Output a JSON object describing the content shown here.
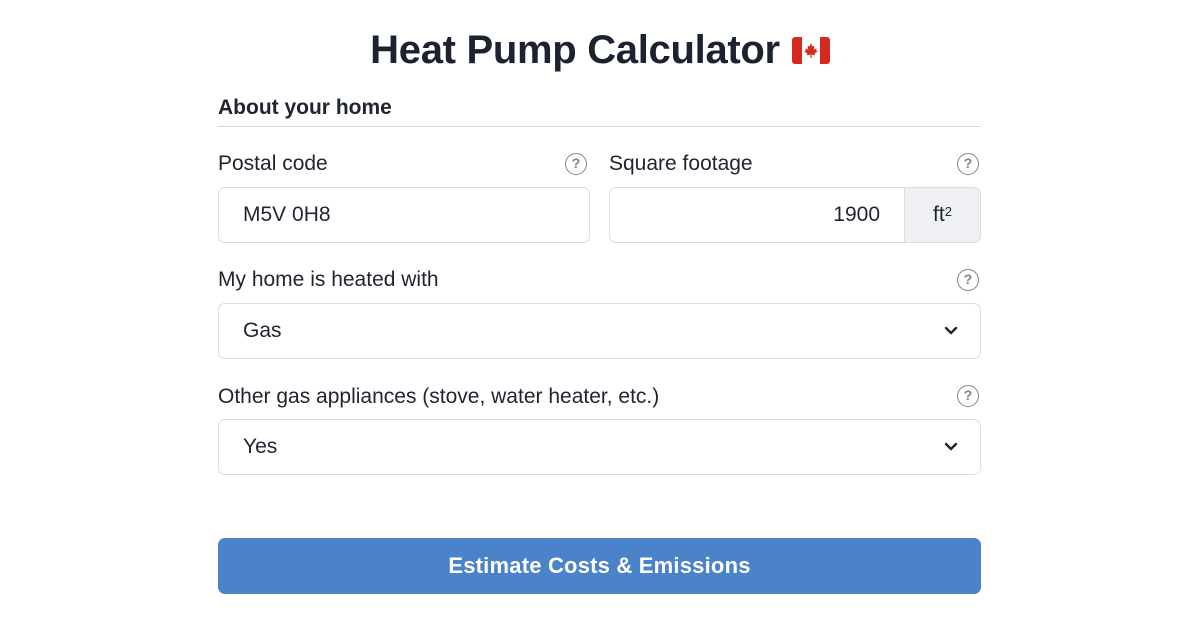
{
  "header": {
    "title": "Heat Pump Calculator",
    "flag_icon": "canada-flag-icon"
  },
  "section": {
    "title": "About your home"
  },
  "form": {
    "postal_code": {
      "label": "Postal code",
      "value": "M5V 0H8",
      "help_icon": "question-circle-icon"
    },
    "square_footage": {
      "label": "Square footage",
      "value": "1900",
      "unit": "ft",
      "unit_exponent": "2",
      "help_icon": "question-circle-icon"
    },
    "heating": {
      "label": "My home is heated with",
      "value": "Gas",
      "help_icon": "question-circle-icon"
    },
    "gas_appliances": {
      "label": "Other gas appliances (stove, water heater, etc.)",
      "value": "Yes",
      "help_icon": "question-circle-icon"
    }
  },
  "actions": {
    "submit_label": "Estimate Costs & Emissions"
  },
  "colors": {
    "primary": "#4a83c9",
    "text": "#1f2430",
    "border": "#d9dde3",
    "flag_red": "#d52b1e"
  }
}
